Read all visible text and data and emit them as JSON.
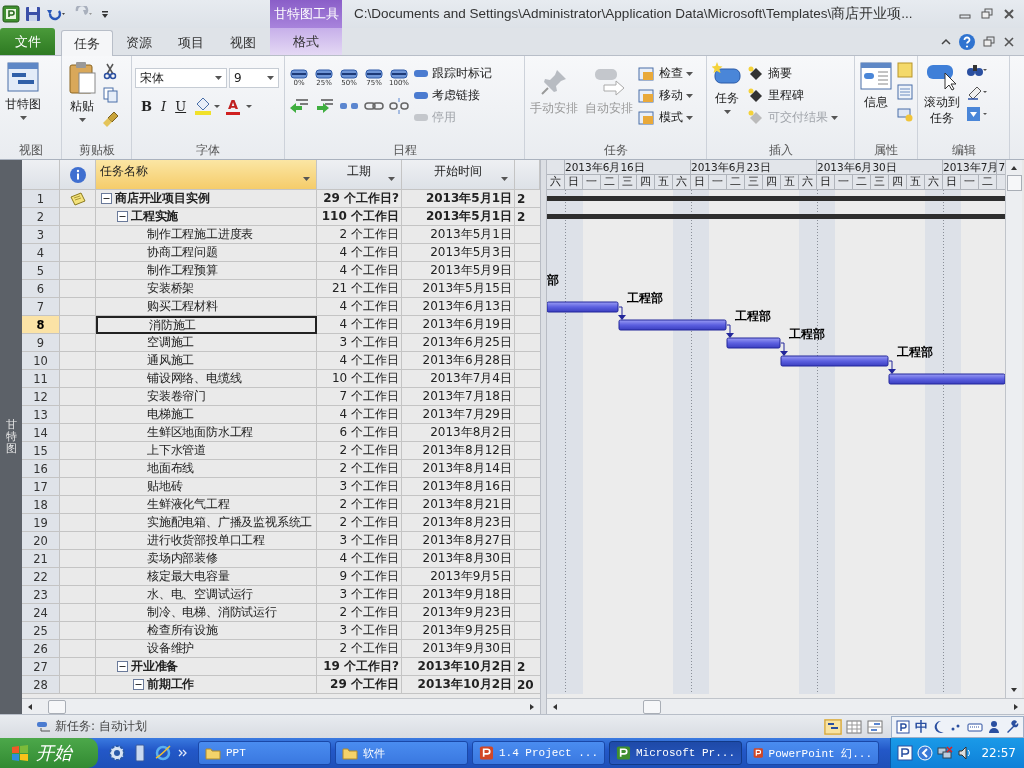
{
  "title_bar": {
    "contextual_header": "甘特图工具",
    "title": "C:\\Documents and Settings\\Administrator\\Application Data\\Microsoft\\Templates\\商店开业项..."
  },
  "tabs": [
    {
      "label": "文件",
      "kind": "file",
      "selected": false
    },
    {
      "label": "任务",
      "kind": "normal",
      "selected": true
    },
    {
      "label": "资源",
      "kind": "normal",
      "selected": false
    },
    {
      "label": "项目",
      "kind": "normal",
      "selected": false
    },
    {
      "label": "视图",
      "kind": "normal",
      "selected": false
    },
    {
      "label": "格式",
      "kind": "contextual",
      "selected": false
    }
  ],
  "ribbon": {
    "view": {
      "label": "视图",
      "button": "甘特图"
    },
    "clipboard": {
      "label": "剪贴板",
      "paste": "粘贴"
    },
    "font": {
      "label": "字体",
      "family": "宋体",
      "size": "9",
      "bold": "B",
      "italic": "I",
      "underline": "U",
      "text_color": "A"
    },
    "schedule": {
      "label": "日程",
      "percents": [
        "0%",
        "25%",
        "50%",
        "75%",
        "100%"
      ],
      "commands": [
        {
          "label": "跟踪时标记",
          "disabled": false
        },
        {
          "label": "考虑链接",
          "disabled": false
        },
        {
          "label": "停用",
          "disabled": true
        }
      ]
    },
    "tasks": {
      "label": "任务",
      "modes": [
        {
          "label": "手动安排",
          "disabled": true
        },
        {
          "label": "自动安排",
          "disabled": true
        }
      ],
      "commands": [
        {
          "label": "检查",
          "disabled": false
        },
        {
          "label": "移动",
          "disabled": false
        },
        {
          "label": "模式",
          "disabled": false
        }
      ]
    },
    "insert": {
      "label": "插入",
      "task": "任务",
      "commands": [
        {
          "label": "摘要",
          "disabled": false
        },
        {
          "label": "里程碑",
          "disabled": false
        },
        {
          "label": "可交付结果",
          "disabled": true
        }
      ]
    },
    "properties": {
      "label": "属性",
      "info": "信息"
    },
    "editing": {
      "label": "编辑",
      "scroll": "滚动到任务"
    }
  },
  "side_label": "甘特图",
  "table": {
    "columns": [
      {
        "label": "任务名称",
        "selected": true
      },
      {
        "label": "工期",
        "selected": false
      },
      {
        "label": "开始时间",
        "selected": false
      }
    ],
    "rows": [
      {
        "id": "1",
        "name": "商店开业项目实例",
        "duration": "29 个工作日?",
        "start": "2013年5月1日",
        "column_4": "2",
        "kind": "summary",
        "note": true,
        "expanded": true,
        "selected": false,
        "children": [
          {
            "id": "2",
            "name": "工程实施",
            "duration": "110 个工作日",
            "start": "2013年5月1日",
            "column_4": "2",
            "kind": "summary",
            "note": false,
            "expanded": true,
            "selected": false,
            "children": [
              {
                "id": "3",
                "name": "制作工程施工进度表",
                "duration": "2 个工作日",
                "start": "2013年5月1日",
                "kind": "task",
                "note": false,
                "selected": false
              },
              {
                "id": "4",
                "name": "协商工程问题",
                "duration": "4 个工作日",
                "start": "2013年5月3日",
                "kind": "task",
                "note": false,
                "selected": false
              },
              {
                "id": "5",
                "name": "制作工程预算",
                "duration": "4 个工作日",
                "start": "2013年5月9日",
                "kind": "task",
                "note": false,
                "selected": false
              },
              {
                "id": "6",
                "name": "安装桥架",
                "duration": "21 个工作日",
                "start": "2013年5月15日",
                "kind": "task",
                "note": false,
                "selected": false,
                "resource": "部"
              },
              {
                "id": "7",
                "name": "购买工程材料",
                "duration": "4 个工作日",
                "start": "2013年6月13日",
                "kind": "task",
                "note": false,
                "selected": false,
                "resource": "工程部"
              },
              {
                "id": "8",
                "name": "消防施工",
                "duration": "4 个工作日",
                "start": "2013年6月19日",
                "kind": "task",
                "note": false,
                "selected": true,
                "resource": "工程部"
              },
              {
                "id": "9",
                "name": "空调施工",
                "duration": "3 个工作日",
                "start": "2013年6月25日",
                "kind": "task",
                "note": false,
                "selected": false,
                "resource": "工程部"
              },
              {
                "id": "10",
                "name": "通风施工",
                "duration": "4 个工作日",
                "start": "2013年6月28日",
                "kind": "task",
                "note": false,
                "selected": false,
                "resource": "工程部"
              },
              {
                "id": "11",
                "name": "铺设网络、电缆线",
                "duration": "10 个工作日",
                "start": "2013年7月4日",
                "kind": "task",
                "note": false,
                "selected": false
              },
              {
                "id": "12",
                "name": "安装卷帘门",
                "duration": "7 个工作日",
                "start": "2013年7月18日",
                "kind": "task",
                "note": false,
                "selected": false
              },
              {
                "id": "13",
                "name": "电梯施工",
                "duration": "4 个工作日",
                "start": "2013年7月29日",
                "kind": "task",
                "note": false,
                "selected": false
              },
              {
                "id": "14",
                "name": "生鲜区地面防水工程",
                "duration": "6 个工作日",
                "start": "2013年8月2日",
                "kind": "task",
                "note": false,
                "selected": false
              },
              {
                "id": "15",
                "name": "上下水管道",
                "duration": "2 个工作日",
                "start": "2013年8月12日",
                "kind": "task",
                "note": false,
                "selected": false
              },
              {
                "id": "16",
                "name": "地面布线",
                "duration": "2 个工作日",
                "start": "2013年8月14日",
                "kind": "task",
                "note": false,
                "selected": false
              },
              {
                "id": "17",
                "name": "贴地砖",
                "duration": "3 个工作日",
                "start": "2013年8月16日",
                "kind": "task",
                "note": false,
                "selected": false
              },
              {
                "id": "18",
                "name": "生鲜液化气工程",
                "duration": "2 个工作日",
                "start": "2013年8月21日",
                "kind": "task",
                "note": false,
                "selected": false
              },
              {
                "id": "19",
                "name": "实施配电箱、广播及监视系统工",
                "duration": "2 个工作日",
                "start": "2013年8月23日",
                "kind": "task",
                "note": false,
                "selected": false
              },
              {
                "id": "20",
                "name": "进行收货部投单口工程",
                "duration": "3 个工作日",
                "start": "2013年8月27日",
                "kind": "task",
                "note": false,
                "selected": false
              },
              {
                "id": "21",
                "name": "卖场内部装修",
                "duration": "4 个工作日",
                "start": "2013年8月30日",
                "kind": "task",
                "note": false,
                "selected": false
              },
              {
                "id": "22",
                "name": "核定最大电容量",
                "duration": "9 个工作日",
                "start": "2013年9月5日",
                "kind": "task",
                "note": false,
                "selected": false
              },
              {
                "id": "23",
                "name": "水、电、空调试运行",
                "duration": "3 个工作日",
                "start": "2013年9月18日",
                "kind": "task",
                "note": false,
                "selected": false
              },
              {
                "id": "24",
                "name": "制冷、电梯、消防试运行",
                "duration": "2 个工作日",
                "start": "2013年9月23日",
                "kind": "task",
                "note": false,
                "selected": false
              },
              {
                "id": "25",
                "name": "检查所有设施",
                "duration": "3 个工作日",
                "start": "2013年9月25日",
                "kind": "task",
                "note": false,
                "selected": false
              },
              {
                "id": "26",
                "name": "设备维护",
                "duration": "2 个工作日",
                "start": "2013年9月30日",
                "kind": "task",
                "note": false,
                "selected": false
              }
            ]
          },
          {
            "id": "27",
            "name": "开业准备",
            "duration": "19 个工作日?",
            "start": "2013年10月2日",
            "column_4": "2",
            "kind": "summary",
            "note": false,
            "expanded": true,
            "selected": false,
            "children": [
              {
                "id": "28",
                "name": "前期工作",
                "duration": "29 个工作日",
                "start": "2013年10月2日",
                "column_4": "20",
                "kind": "summary",
                "note": false,
                "expanded": true,
                "selected": false
              }
            ]
          }
        ]
      }
    ]
  },
  "timescale": {
    "weeks": [
      {
        "days": [
          "六"
        ]
      },
      {
        "label": "2013年6月16日",
        "days": [
          "日",
          "一",
          "二",
          "三",
          "四",
          "五",
          "六"
        ]
      },
      {
        "label": "2013年6月23日",
        "days": [
          "日",
          "一",
          "二",
          "三",
          "四",
          "五",
          "六"
        ]
      },
      {
        "label": "2013年6月30日",
        "days": [
          "日",
          "一",
          "二",
          "三",
          "四",
          "五",
          "六"
        ]
      },
      {
        "label": "2013年7月7",
        "days": [
          "日",
          "一",
          "二"
        ]
      }
    ]
  },
  "status_bar": {
    "new_task": "新任务: 自动计划",
    "ime": "中"
  },
  "taskbar": {
    "start": "开始",
    "buttons": [
      {
        "label": "PPT",
        "kind": "folder",
        "selected": false
      },
      {
        "label": "软件",
        "kind": "folder",
        "selected": false
      },
      {
        "label": "1.4 Project ...",
        "kind": "powerpoint",
        "selected": false
      },
      {
        "label": "Microsoft Pr...",
        "kind": "project",
        "selected": true
      },
      {
        "label": "PowerPoint 幻...",
        "kind": "powerpoint",
        "selected": false
      }
    ],
    "clock": "22:57"
  }
}
